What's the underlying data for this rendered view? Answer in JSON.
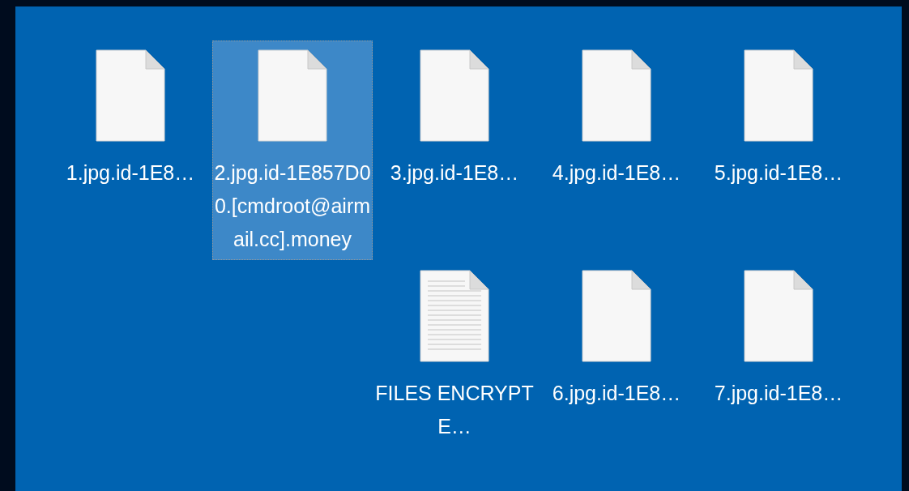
{
  "files": [
    {
      "kind": "document",
      "name": "1.jpg.id-1E8…",
      "selected": false
    },
    {
      "kind": "document",
      "name": "2.jpg.id-1E857D00.[cmdroot@airmail.cc].money",
      "selected": true
    },
    {
      "kind": "document",
      "name": "3.jpg.id-1E8…",
      "selected": false
    },
    {
      "kind": "document",
      "name": "4.jpg.id-1E8…",
      "selected": false
    },
    {
      "kind": "document",
      "name": "5.jpg.id-1E8…",
      "selected": false
    },
    {
      "kind": "text",
      "name": "FILES ENCRYPTE…",
      "selected": false
    },
    {
      "kind": "document",
      "name": "6.jpg.id-1E8…",
      "selected": false
    },
    {
      "kind": "document",
      "name": "7.jpg.id-1E8…",
      "selected": false
    }
  ]
}
